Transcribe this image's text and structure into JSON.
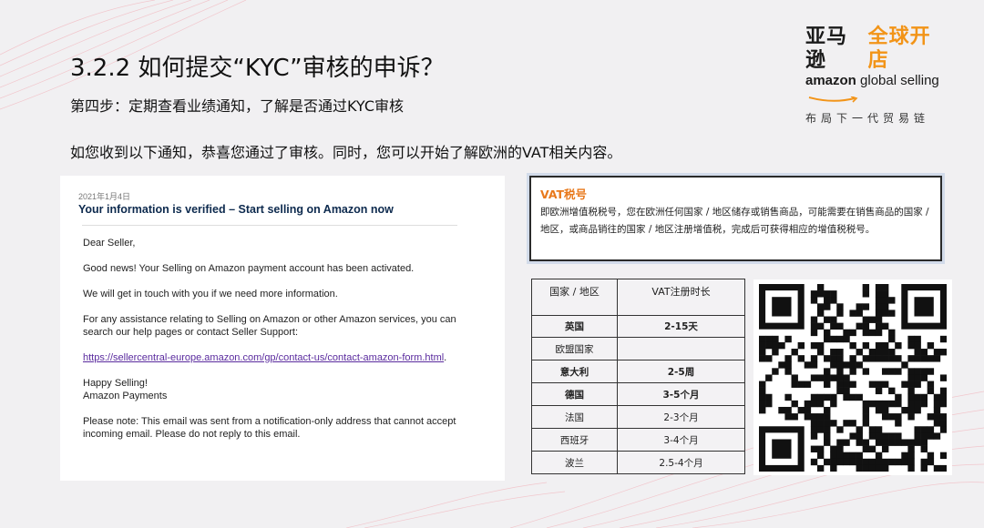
{
  "slide": {
    "title": "3.2.2 如何提交“KYC”审核的申诉？",
    "step": "第四步：定期查看业绩通知，了解是否通过KYC审核",
    "notice": "如您收到以下通知，恭喜您通过了审核。同时，您可以开始了解欧洲的VAT相关内容。"
  },
  "logo": {
    "cn_part1": "亚马逊",
    "cn_part2": "全球开店",
    "en_part1": "amazon",
    "en_part2": "global selling",
    "tagline": "布局下一代贸易链",
    "brand_color": "#f29418"
  },
  "email": {
    "date": "2021年1月4日",
    "subject": "Your information is verified – Start selling on Amazon now",
    "greeting": "Dear Seller,",
    "para1": "Good news! Your Selling on Amazon payment account has been activated.",
    "para2": "We will get in touch with you if we need more information.",
    "para3": "For any assistance relating to Selling on Amazon or other Amazon services, you can search our help pages or contact Seller Support:",
    "link": "https://sellercentral-europe.amazon.com/gp/contact-us/contact-amazon-form.html",
    "link_suffix": ".",
    "closing": "Happy Selling!",
    "signature": "Amazon Payments",
    "note": "Please note: This email was sent from a notification-only address that cannot accept incoming email. Please do not reply to this email."
  },
  "vat_info": {
    "title": "VAT税号",
    "text": "即欧洲增值税税号，您在欧洲任何国家 / 地区储存或销售商品，可能需要在销售商品的国家 / 地区，或商品销往的国家 / 地区注册增值税，完成后可获得相应的增值税税号。",
    "title_color": "#e8791c"
  },
  "vat_table": {
    "headers": [
      "国家 / 地区",
      "VAT注册时长"
    ],
    "rows": [
      {
        "country": "英国",
        "duration": "2-15天",
        "bold": true
      },
      {
        "country": "欧盟国家",
        "duration": "",
        "bold": false
      },
      {
        "country": "意大利",
        "duration": "2-5周",
        "bold": true
      },
      {
        "country": "德国",
        "duration": "3-5个月",
        "bold": true
      },
      {
        "country": "法国",
        "duration": "2-3个月",
        "bold": false
      },
      {
        "country": "西班牙",
        "duration": "3-4个月",
        "bold": false
      },
      {
        "country": "波兰",
        "duration": "2.5-4个月",
        "bold": false
      }
    ]
  },
  "qr_code": {
    "icon": "qr-code-icon"
  }
}
